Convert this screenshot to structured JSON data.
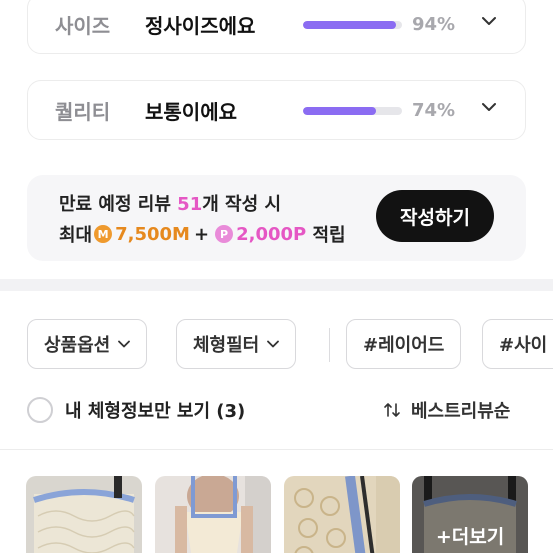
{
  "ratings": [
    {
      "label": "사이즈",
      "value": "정사이즈에요",
      "fraction": 0.94,
      "percent": "94%",
      "icon": "chevron-down-icon"
    },
    {
      "label": "퀄리티",
      "value": "보통이에요",
      "fraction": 0.74,
      "percent": "74%",
      "icon": "chevron-down-icon"
    }
  ],
  "promo": {
    "line1_prefix": "만료 예정 리뷰 ",
    "line1_count": "51",
    "line1_suffix": "개 작성 시",
    "line2_prefix": "최대",
    "mileage_badge": "M",
    "mileage_amount": "7,500M",
    "plus": "+",
    "point_badge": "P",
    "point_amount": "2,000P",
    "line2_suffix": " 적립",
    "button_label": "작성하기",
    "colors": {
      "highlight": "#e557c4",
      "mileage": "#e6891e"
    }
  },
  "filters": {
    "option_label": "상품옵션",
    "body_filter_label": "체형필터",
    "tag_1": "#레이어드",
    "tag_2": "#사이"
  },
  "my_body_toggle": {
    "label": "내 체형정보만 보기 (3)",
    "checked": false
  },
  "sort": {
    "label": "베스트리뷰순",
    "icon": "sort-arrows-icon"
  },
  "photos": {
    "more_label": "+더보기"
  },
  "accent_color": "#8b6cf2"
}
